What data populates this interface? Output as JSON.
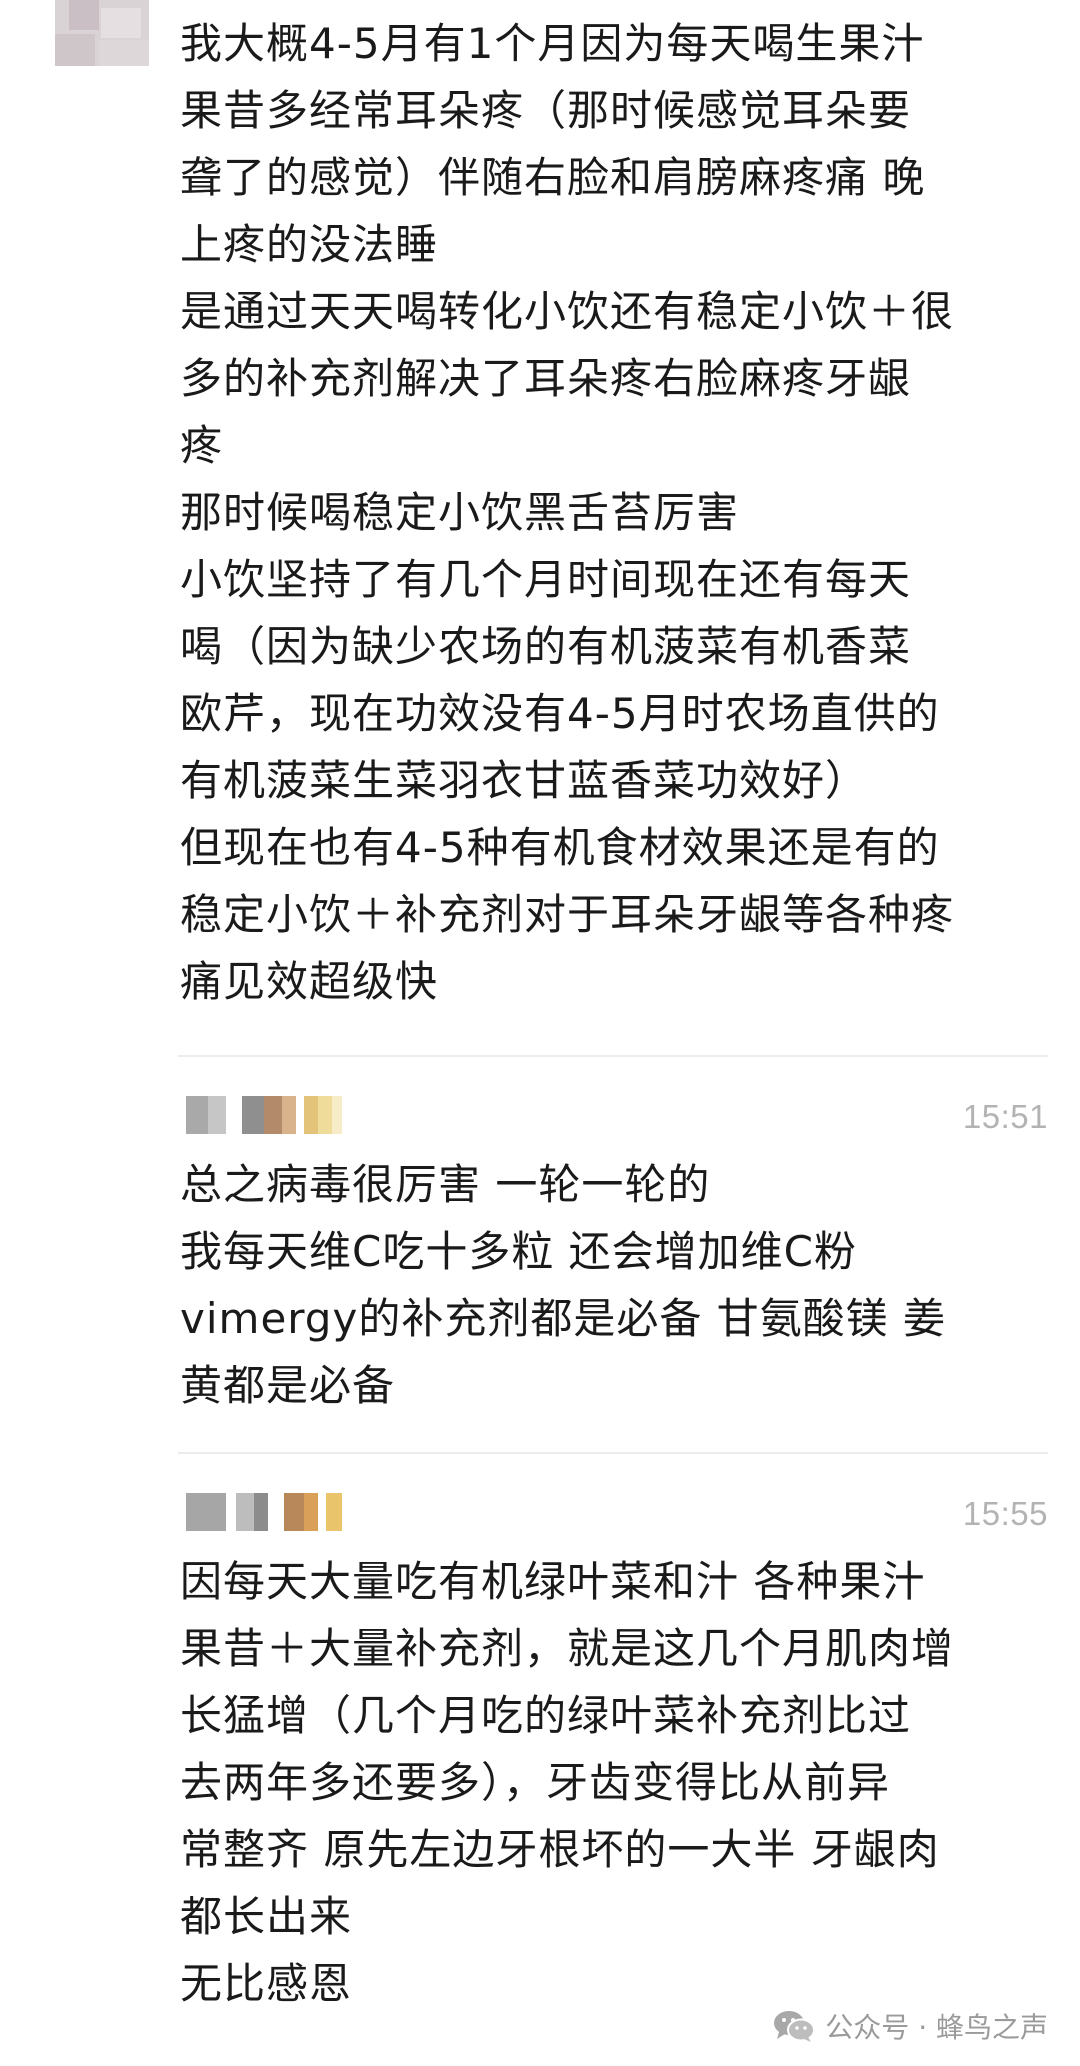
{
  "comments": [
    {
      "lines": [
        "我大概4-5月有1个月因为每天喝生果汁",
        "果昔多经常耳朵疼（那时候感觉耳朵要",
        "聋了的感觉）伴随右脸和肩膀麻疼痛 晚",
        "上疼的没法睡",
        "是通过天天喝转化小饮还有稳定小饮＋很",
        "多的补充剂解决了耳朵疼右脸麻疼牙龈",
        "疼",
        "那时候喝稳定小饮黑舌苔厉害",
        "小饮坚持了有几个月时间现在还有每天",
        "喝（因为缺少农场的有机菠菜有机香菜",
        "欧芹，现在功效没有4-5月时农场直供的",
        "有机菠菜生菜羽衣甘蓝香菜功效好）",
        "但现在也有4-5种有机食材效果还是有的",
        "稳定小饮＋补充剂对于耳朵牙龈等各种疼",
        "痛见效超级快"
      ]
    },
    {
      "time": "15:51",
      "lines": [
        "总之病毒很厉害 一轮一轮的",
        "我每天维C吃十多粒 还会增加维C粉",
        "vimergy的补充剂都是必备  甘氨酸镁 姜",
        "黄都是必备"
      ]
    },
    {
      "time": "15:55",
      "lines": [
        "因每天大量吃有机绿叶菜和汁 各种果汁",
        "果昔＋大量补充剂，就是这几个月肌肉增",
        "长猛增（几个月吃的绿叶菜补充剂比过",
        "去两年多还要多），牙齿变得比从前异",
        "常整齐 原先左边牙根坏的一大半 牙龈肉",
        "都长出来",
        "无比感恩"
      ]
    }
  ],
  "watermark": {
    "text": "公众号 · 蜂鸟之声",
    "icon": "wechat-icon"
  },
  "colors": {
    "text": "#1a1a1a",
    "timestamp": "#b3b3b3",
    "divider": "#ececec",
    "watermark": "#9a9a9a"
  }
}
